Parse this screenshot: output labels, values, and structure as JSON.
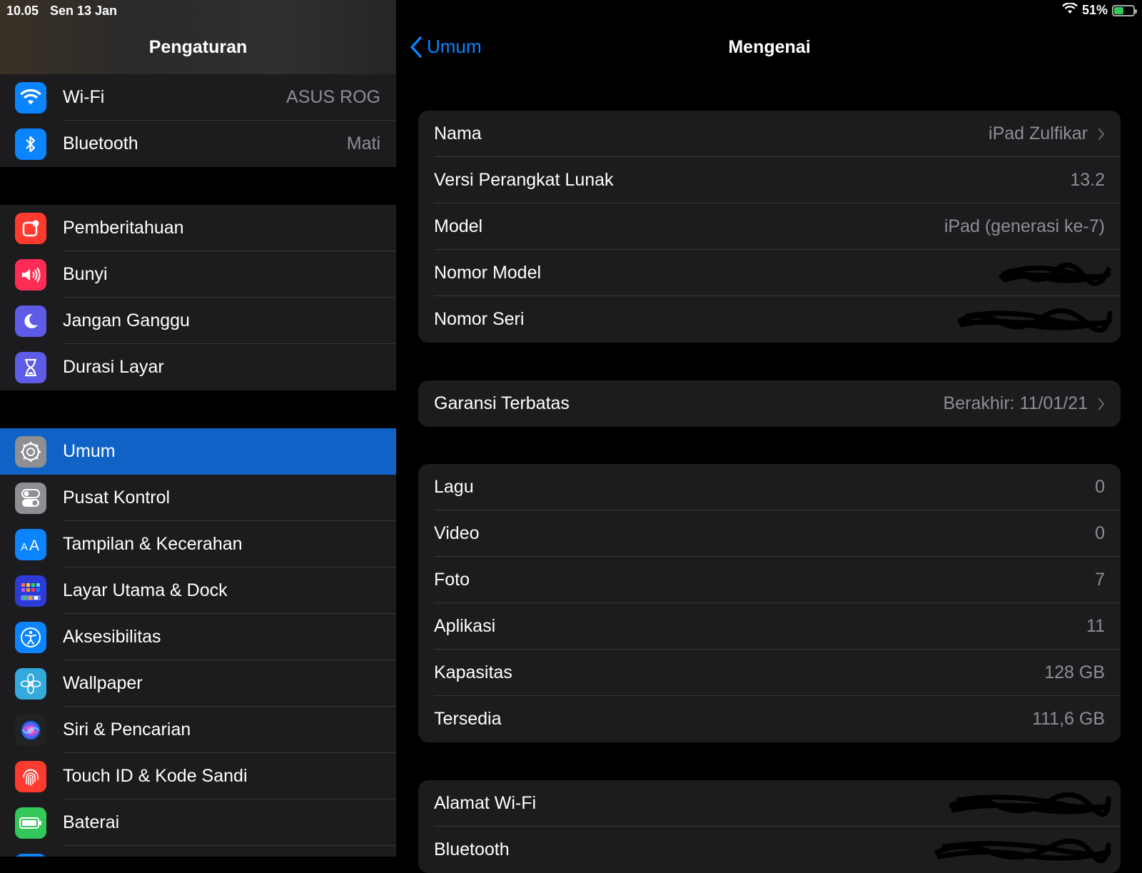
{
  "status_bar": {
    "time": "10.05",
    "date": "Sen 13 Jan",
    "battery": "51%",
    "battery_level": 0.51
  },
  "sidebar": {
    "title": "Pengaturan",
    "groups": [
      {
        "items": [
          {
            "label": "Wi-Fi",
            "value": "ASUS ROG",
            "icon": "wifi-icon",
            "color": "#0a84ff"
          },
          {
            "label": "Bluetooth",
            "value": "Mati",
            "icon": "bluetooth-icon",
            "color": "#0a84ff"
          }
        ]
      },
      {
        "items": [
          {
            "label": "Pemberitahuan",
            "icon": "notifications-icon",
            "color": "#ff3b30"
          },
          {
            "label": "Bunyi",
            "icon": "sound-icon",
            "color": "#ff2d55"
          },
          {
            "label": "Jangan Ganggu",
            "icon": "moon-icon",
            "color": "#5e5ce6"
          },
          {
            "label": "Durasi Layar",
            "icon": "hourglass-icon",
            "color": "#5e5ce6"
          }
        ]
      },
      {
        "items": [
          {
            "label": "Umum",
            "icon": "gear-icon",
            "color": "#8e8e93",
            "selected": true
          },
          {
            "label": "Pusat Kontrol",
            "icon": "toggles-icon",
            "color": "#8e8e93"
          },
          {
            "label": "Tampilan & Kecerahan",
            "icon": "display-icon",
            "color": "#0a84ff"
          },
          {
            "label": "Layar Utama & Dock",
            "icon": "home-grid-icon",
            "color": "#2c3bd6"
          },
          {
            "label": "Aksesibilitas",
            "icon": "accessibility-icon",
            "color": "#0a84ff"
          },
          {
            "label": "Wallpaper",
            "icon": "flower-icon",
            "color": "#34aadc"
          },
          {
            "label": "Siri & Pencarian",
            "icon": "siri-icon",
            "color": "#222"
          },
          {
            "label": "Touch ID & Kode Sandi",
            "icon": "fingerprint-icon",
            "color": "#ff3b30"
          },
          {
            "label": "Baterai",
            "icon": "battery-icon",
            "color": "#34c759"
          }
        ]
      }
    ]
  },
  "detail": {
    "back_label": "Umum",
    "title": "Mengenai",
    "sections": [
      {
        "rows": [
          {
            "label": "Nama",
            "value": "iPad Zulfikar",
            "chevron": true
          },
          {
            "label": "Versi Perangkat Lunak",
            "value": "13.2"
          },
          {
            "label": "Model",
            "value": "iPad (generasi ke-7)"
          },
          {
            "label": "Nomor Model",
            "redacted": true
          },
          {
            "label": "Nomor Seri",
            "redacted": true
          }
        ]
      },
      {
        "rows": [
          {
            "label": "Garansi Terbatas",
            "value": "Berakhir: 11/01/21",
            "chevron": true
          }
        ]
      },
      {
        "rows": [
          {
            "label": "Lagu",
            "value": "0"
          },
          {
            "label": "Video",
            "value": "0"
          },
          {
            "label": "Foto",
            "value": "7"
          },
          {
            "label": "Aplikasi",
            "value": "11"
          },
          {
            "label": "Kapasitas",
            "value": "128 GB"
          },
          {
            "label": "Tersedia",
            "value": "111,6 GB"
          }
        ]
      },
      {
        "rows": [
          {
            "label": "Alamat Wi-Fi",
            "redacted": true
          },
          {
            "label": "Bluetooth",
            "redacted": true
          }
        ]
      }
    ]
  }
}
